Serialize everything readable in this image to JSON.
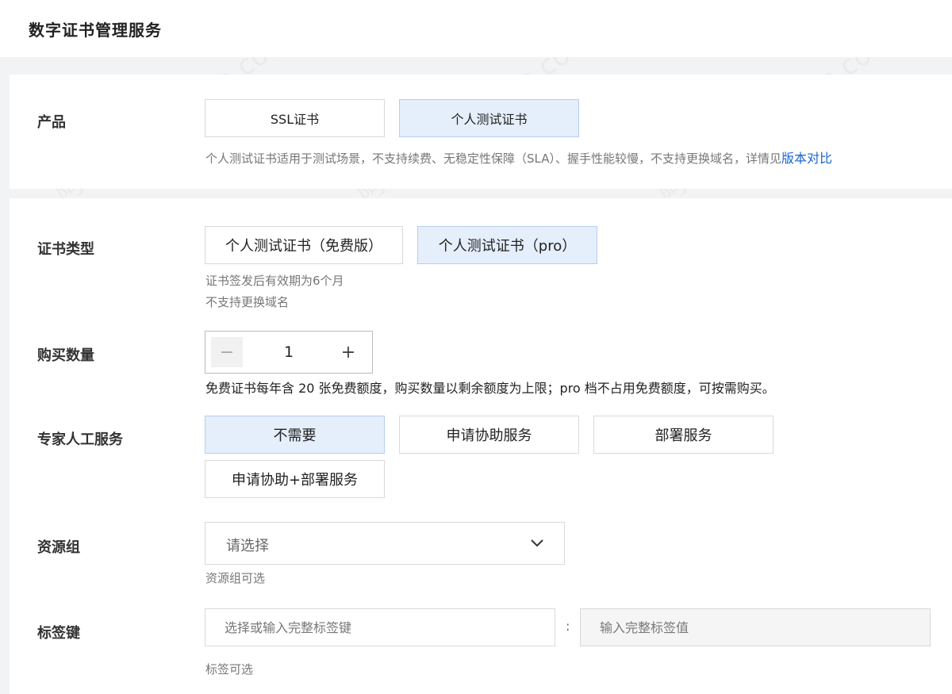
{
  "header": {
    "title": "数字证书管理服务"
  },
  "product": {
    "label": "产品",
    "options": [
      "SSL证书",
      "个人测试证书"
    ],
    "hint": "个人测试证书适用于测试场景，不支持续费、无稳定性保障（SLA）、握手性能较慢，不支持更换域名，详情见",
    "hint_link": "版本对比"
  },
  "cert_type": {
    "label": "证书类型",
    "options": [
      "个人测试证书（免费版）",
      "个人测试证书（pro）"
    ],
    "hint1": "证书签发后有效期为6个月",
    "hint2": "不支持更换域名"
  },
  "quantity": {
    "label": "购买数量",
    "minus": "−",
    "value": "1",
    "plus": "+",
    "hint": "免费证书每年含 20 张免费额度，购买数量以剩余额度为上限；pro 档不占用免费额度，可按需购买。"
  },
  "expert": {
    "label": "专家人工服务",
    "options": [
      "不需要",
      "申请协助服务",
      "部署服务",
      "申请协助+部署服务"
    ]
  },
  "resource_group": {
    "label": "资源组",
    "placeholder": "请选择",
    "hint": "资源组可选"
  },
  "tag": {
    "label": "标签键",
    "key_placeholder": "选择或输入完整标签键",
    "separator": ":",
    "value_placeholder": "输入完整标签值",
    "hint": "标签可选"
  },
  "colors": {
    "selected_bg": "#e5eefb",
    "selected_border": "#b7cdf0",
    "link": "#1a66d2"
  }
}
